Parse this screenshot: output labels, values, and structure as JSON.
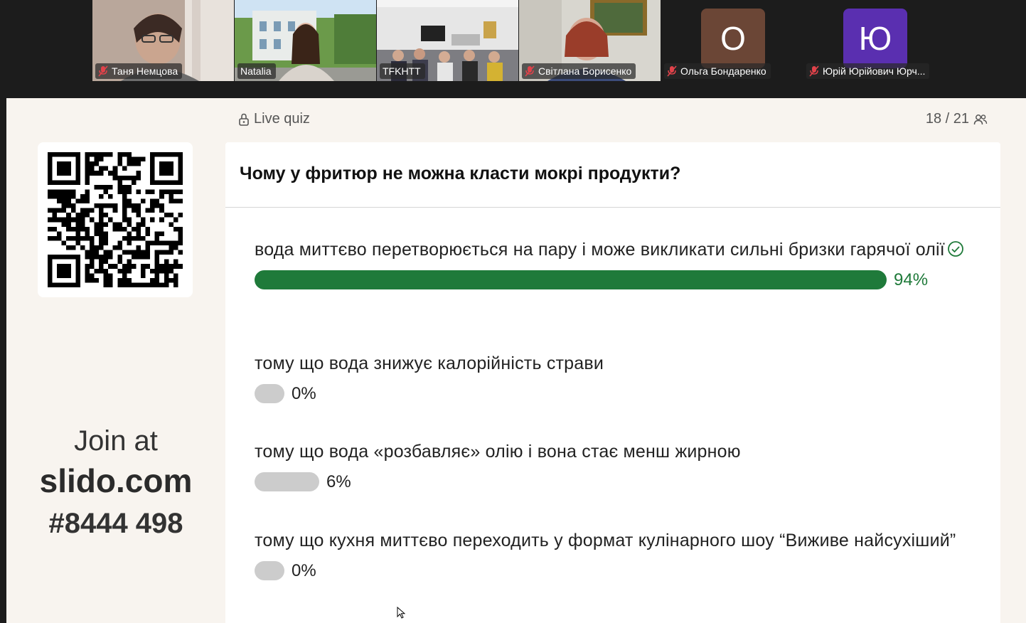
{
  "participants": [
    {
      "name": "Таня Немцова",
      "muted": true
    },
    {
      "name": "Natalia",
      "muted": false,
      "active": true
    },
    {
      "name": "TFKHTT",
      "muted": false
    },
    {
      "name": "Світлана Борисенко",
      "muted": true
    },
    {
      "name": "Ольга Бондаренко",
      "muted": true,
      "avatar_letter": "О",
      "avatar_color": "#6b4636"
    },
    {
      "name": "Юрій Юрійович Юрч...",
      "muted": true,
      "avatar_letter": "Ю",
      "avatar_color": "#5a2fb0"
    }
  ],
  "slido": {
    "join_label": "Join at",
    "join_domain": "slido.com",
    "join_code": "#8444 498",
    "mode_label": "Live quiz",
    "counter": "18 / 21",
    "question": "Чому у фритюр не можна класти мокрі продукти?",
    "options": [
      {
        "text": "вода миттєво перетворюється на пару і може викликати сильні бризки гарячої олії",
        "percent": 94,
        "percent_label": "94%",
        "correct": true
      },
      {
        "text": "тому що вода знижує калорійність страви",
        "percent": 0,
        "percent_label": "0%",
        "correct": false
      },
      {
        "text": "тому що вода «розбавляє» олію і вона стає менш жирною",
        "percent": 6,
        "percent_label": "6%",
        "correct": false
      },
      {
        "text": "тому що кухня миттєво переходить у формат кулінарного шоу “Виживе найсухіший”",
        "percent": 0,
        "percent_label": "0%",
        "correct": false
      }
    ]
  },
  "colors": {
    "correct": "#1f7a3a",
    "neutral_bar": "#cccccc",
    "active_tile": "#2ee08f",
    "muted_mic": "#e0424a"
  }
}
